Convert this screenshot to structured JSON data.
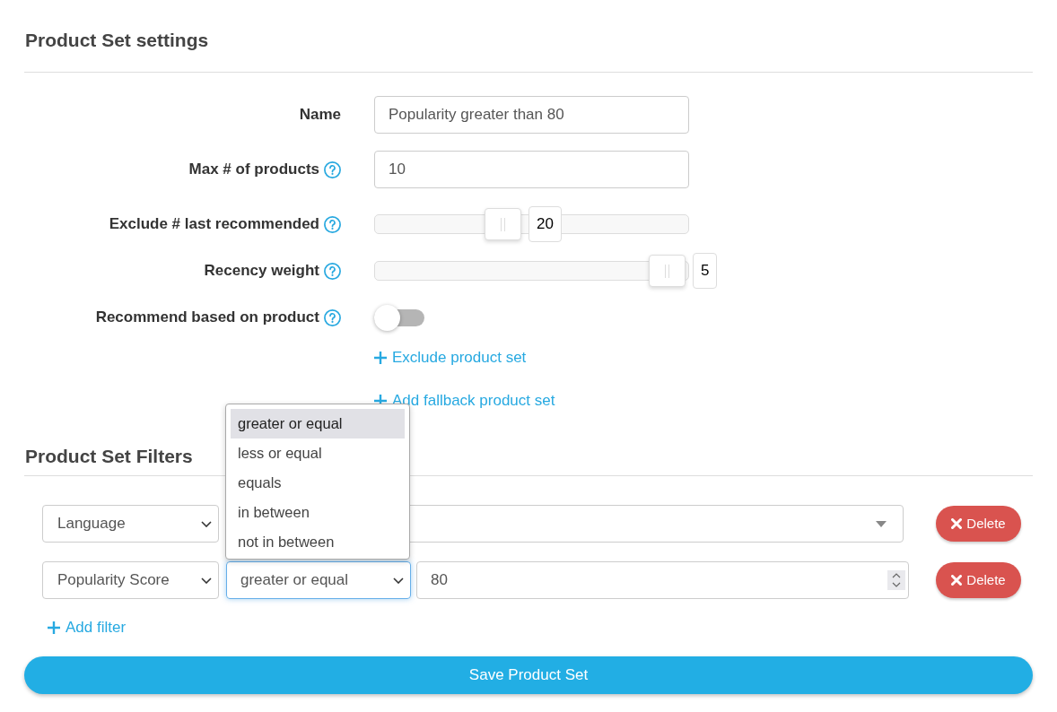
{
  "settings": {
    "title": "Product Set settings",
    "fields": [
      {
        "kind": "text",
        "label": "Name",
        "help": false,
        "value": "Popularity greater than 80"
      },
      {
        "kind": "text",
        "label": "Max # of products",
        "help": true,
        "value": "10"
      },
      {
        "kind": "slider",
        "label": "Exclude # last recommended",
        "help": true,
        "level": 0.4,
        "reading": "20"
      },
      {
        "kind": "slider",
        "label": "Recency weight",
        "help": true,
        "level": 1.0,
        "reading": "5"
      },
      {
        "kind": "toggle",
        "label": "Recommend based on product",
        "help": true,
        "on": false
      }
    ],
    "links": [
      "Exclude product set",
      "Add fallback product set"
    ]
  },
  "filters": {
    "title": "Product Set Filters",
    "rows": [
      {
        "kind": "select",
        "attribute": "Language",
        "delete": "Delete"
      },
      {
        "kind": "number",
        "attribute": "Popularity Score",
        "operator": {
          "value": "greater or equal",
          "focused": true,
          "expanded": true,
          "options": [
            {
              "label": "greater or equal",
              "selected": true
            },
            {
              "label": "less or equal",
              "selected": false
            },
            {
              "label": "equals",
              "selected": false
            },
            {
              "label": "in between",
              "selected": false
            },
            {
              "label": "not in between",
              "selected": false
            }
          ]
        },
        "value": "80",
        "delete": "Delete"
      }
    ],
    "add_filter": "Add filter"
  },
  "save_button": "Save Product Set"
}
